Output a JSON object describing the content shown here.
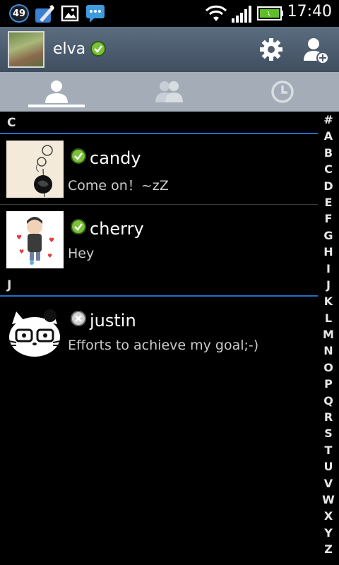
{
  "status_bar": {
    "notification_count": "49",
    "time": "17:40"
  },
  "header": {
    "user_name": "elva",
    "status": "online"
  },
  "tabs": [
    {
      "icon": "person-icon",
      "active": true
    },
    {
      "icon": "group-icon",
      "active": false
    },
    {
      "icon": "clock-icon",
      "active": false
    }
  ],
  "sections": [
    {
      "letter": "C",
      "contacts": [
        {
          "name": "candy",
          "message": "Come on！~zZ",
          "status": "online"
        },
        {
          "name": "cherry",
          "message": "Hey",
          "status": "online"
        }
      ]
    },
    {
      "letter": "J",
      "contacts": [
        {
          "name": "justin",
          "message": "Efforts to achieve my goal;-)",
          "status": "offline"
        }
      ]
    }
  ],
  "alphabet_index": [
    "#",
    "A",
    "B",
    "C",
    "D",
    "E",
    "F",
    "G",
    "H",
    "I",
    "J",
    "K",
    "L",
    "M",
    "N",
    "O",
    "P",
    "Q",
    "R",
    "S",
    "T",
    "U",
    "V",
    "W",
    "X",
    "Y",
    "Z"
  ],
  "colors": {
    "header_top": "#5b6d80",
    "tab_bar": "#a3acb7",
    "section_divider": "#1f6fc8",
    "online_green": "#7cc13a"
  }
}
